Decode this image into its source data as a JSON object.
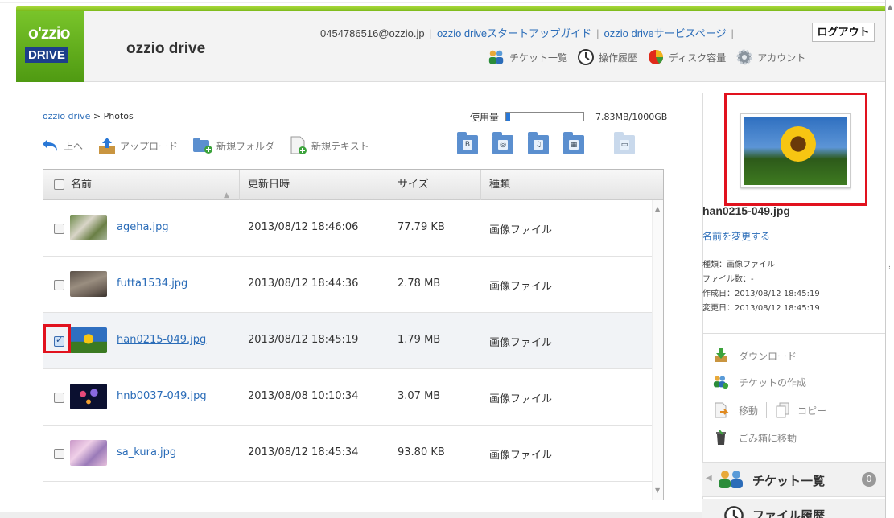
{
  "header": {
    "logo_line1": "o'zzio",
    "logo_line2": "DRIVE",
    "brand": "ozzio drive",
    "account_email": "0454786516@ozzio.jp",
    "links": [
      "ozzio driveスタートアップガイド",
      "ozzio driveサービスページ"
    ],
    "logout": "ログアウト",
    "icons": [
      {
        "icon": "tickets-icon",
        "label": "チケット一覧"
      },
      {
        "icon": "history-icon",
        "label": "操作履歴"
      },
      {
        "icon": "disk-usage-icon",
        "label": "ディスク容量"
      },
      {
        "icon": "account-gear-icon",
        "label": "アカウント"
      }
    ]
  },
  "breadcrumb": {
    "root": "ozzio drive",
    "sep": ">",
    "current": "Photos"
  },
  "usage": {
    "label": "使用量",
    "value": "7.83MB/1000GB",
    "fraction": 0.05
  },
  "toolbar": {
    "up": "上へ",
    "upload": "アップロード",
    "new_folder": "新規フォルダ",
    "new_text": "新規テキスト"
  },
  "table": {
    "columns": {
      "name": "名前",
      "modified": "更新日時",
      "size": "サイズ",
      "type": "種類"
    },
    "rows": [
      {
        "name": "ageha.jpg",
        "modified": "2013/08/12 18:46:06",
        "size": "77.79 KB",
        "type": "画像ファイル",
        "checked": false
      },
      {
        "name": "futta1534.jpg",
        "modified": "2013/08/12 18:44:36",
        "size": "2.78 MB",
        "type": "画像ファイル",
        "checked": false
      },
      {
        "name": "han0215-049.jpg",
        "modified": "2013/08/12 18:45:19",
        "size": "1.79 MB",
        "type": "画像ファイル",
        "checked": true
      },
      {
        "name": "hnb0037-049.jpg",
        "modified": "2013/08/08 10:10:34",
        "size": "3.07 MB",
        "type": "画像ファイル",
        "checked": false
      },
      {
        "name": "sa_kura.jpg",
        "modified": "2013/08/12 18:45:34",
        "size": "93.80 KB",
        "type": "画像ファイル",
        "checked": false
      }
    ]
  },
  "details": {
    "filename": "han0215-049.jpg",
    "rename": "名前を変更する",
    "type": "種類：画像ファイル",
    "count": "ファイル数：-",
    "created": "作成日：2013/08/12 18:45:19",
    "updated": "変更日：2013/08/12 18:45:19",
    "actions": {
      "download": "ダウンロード",
      "create_ticket": "チケットの作成",
      "move": "移動",
      "copy": "コピー",
      "trash": "ごみ箱に移動"
    },
    "tickets_label": "チケット一覧",
    "tickets_count": "0",
    "history_label": "ファイル履歴"
  },
  "colors": {
    "accent_green": "#6fb820",
    "link_blue": "#2a6cb8",
    "highlight_red": "#e1121e"
  }
}
